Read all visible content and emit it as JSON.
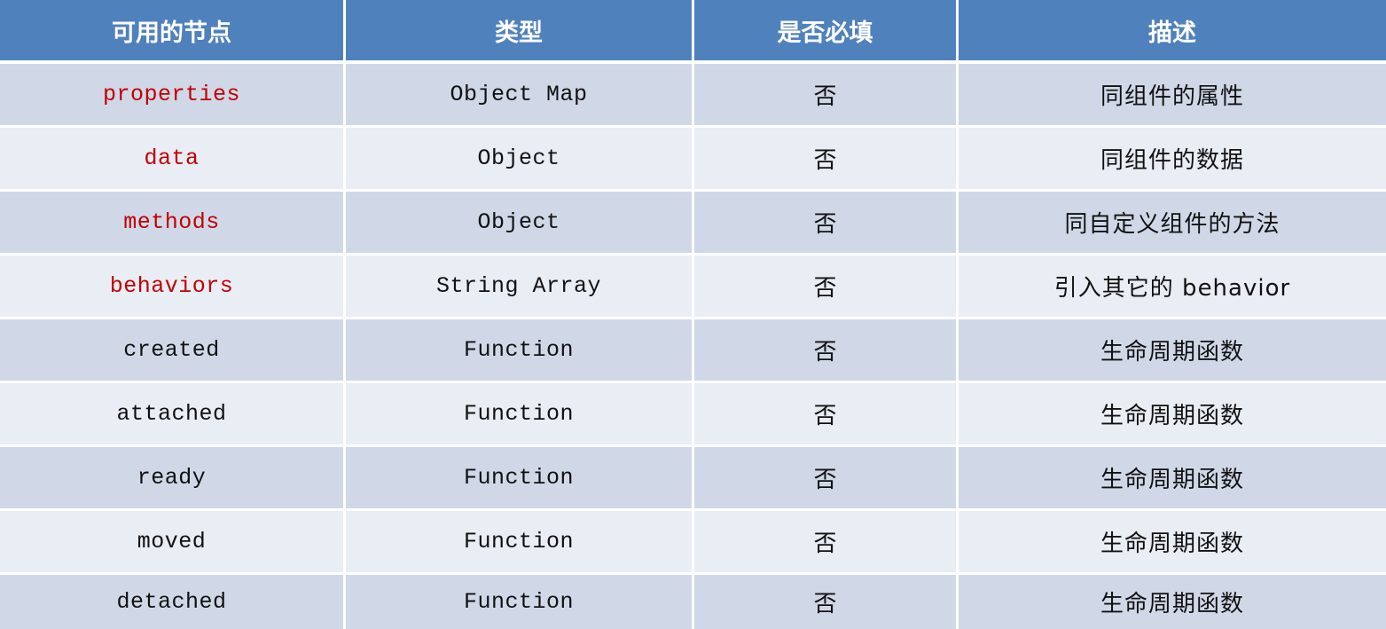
{
  "table": {
    "headers": [
      "可用的节点",
      "类型",
      "是否必填",
      "描述"
    ],
    "highlight_color": "#c00000",
    "header_color": "#4f81bd",
    "rows": [
      {
        "node": "properties",
        "type": "Object Map",
        "required": "否",
        "description": "同组件的属性",
        "highlight": true
      },
      {
        "node": "data",
        "type": "Object",
        "required": "否",
        "description": "同组件的数据",
        "highlight": true
      },
      {
        "node": "methods",
        "type": "Object",
        "required": "否",
        "description": "同自定义组件的方法",
        "highlight": true
      },
      {
        "node": "behaviors",
        "type": "String Array",
        "required": "否",
        "description": "引入其它的 behavior",
        "highlight": true
      },
      {
        "node": "created",
        "type": "Function",
        "required": "否",
        "description": "生命周期函数",
        "highlight": false
      },
      {
        "node": "attached",
        "type": "Function",
        "required": "否",
        "description": "生命周期函数",
        "highlight": false
      },
      {
        "node": "ready",
        "type": "Function",
        "required": "否",
        "description": "生命周期函数",
        "highlight": false
      },
      {
        "node": "moved",
        "type": "Function",
        "required": "否",
        "description": "生命周期函数",
        "highlight": false
      },
      {
        "node": "detached",
        "type": "Function",
        "required": "否",
        "description": "生命周期函数",
        "highlight": false
      }
    ]
  }
}
